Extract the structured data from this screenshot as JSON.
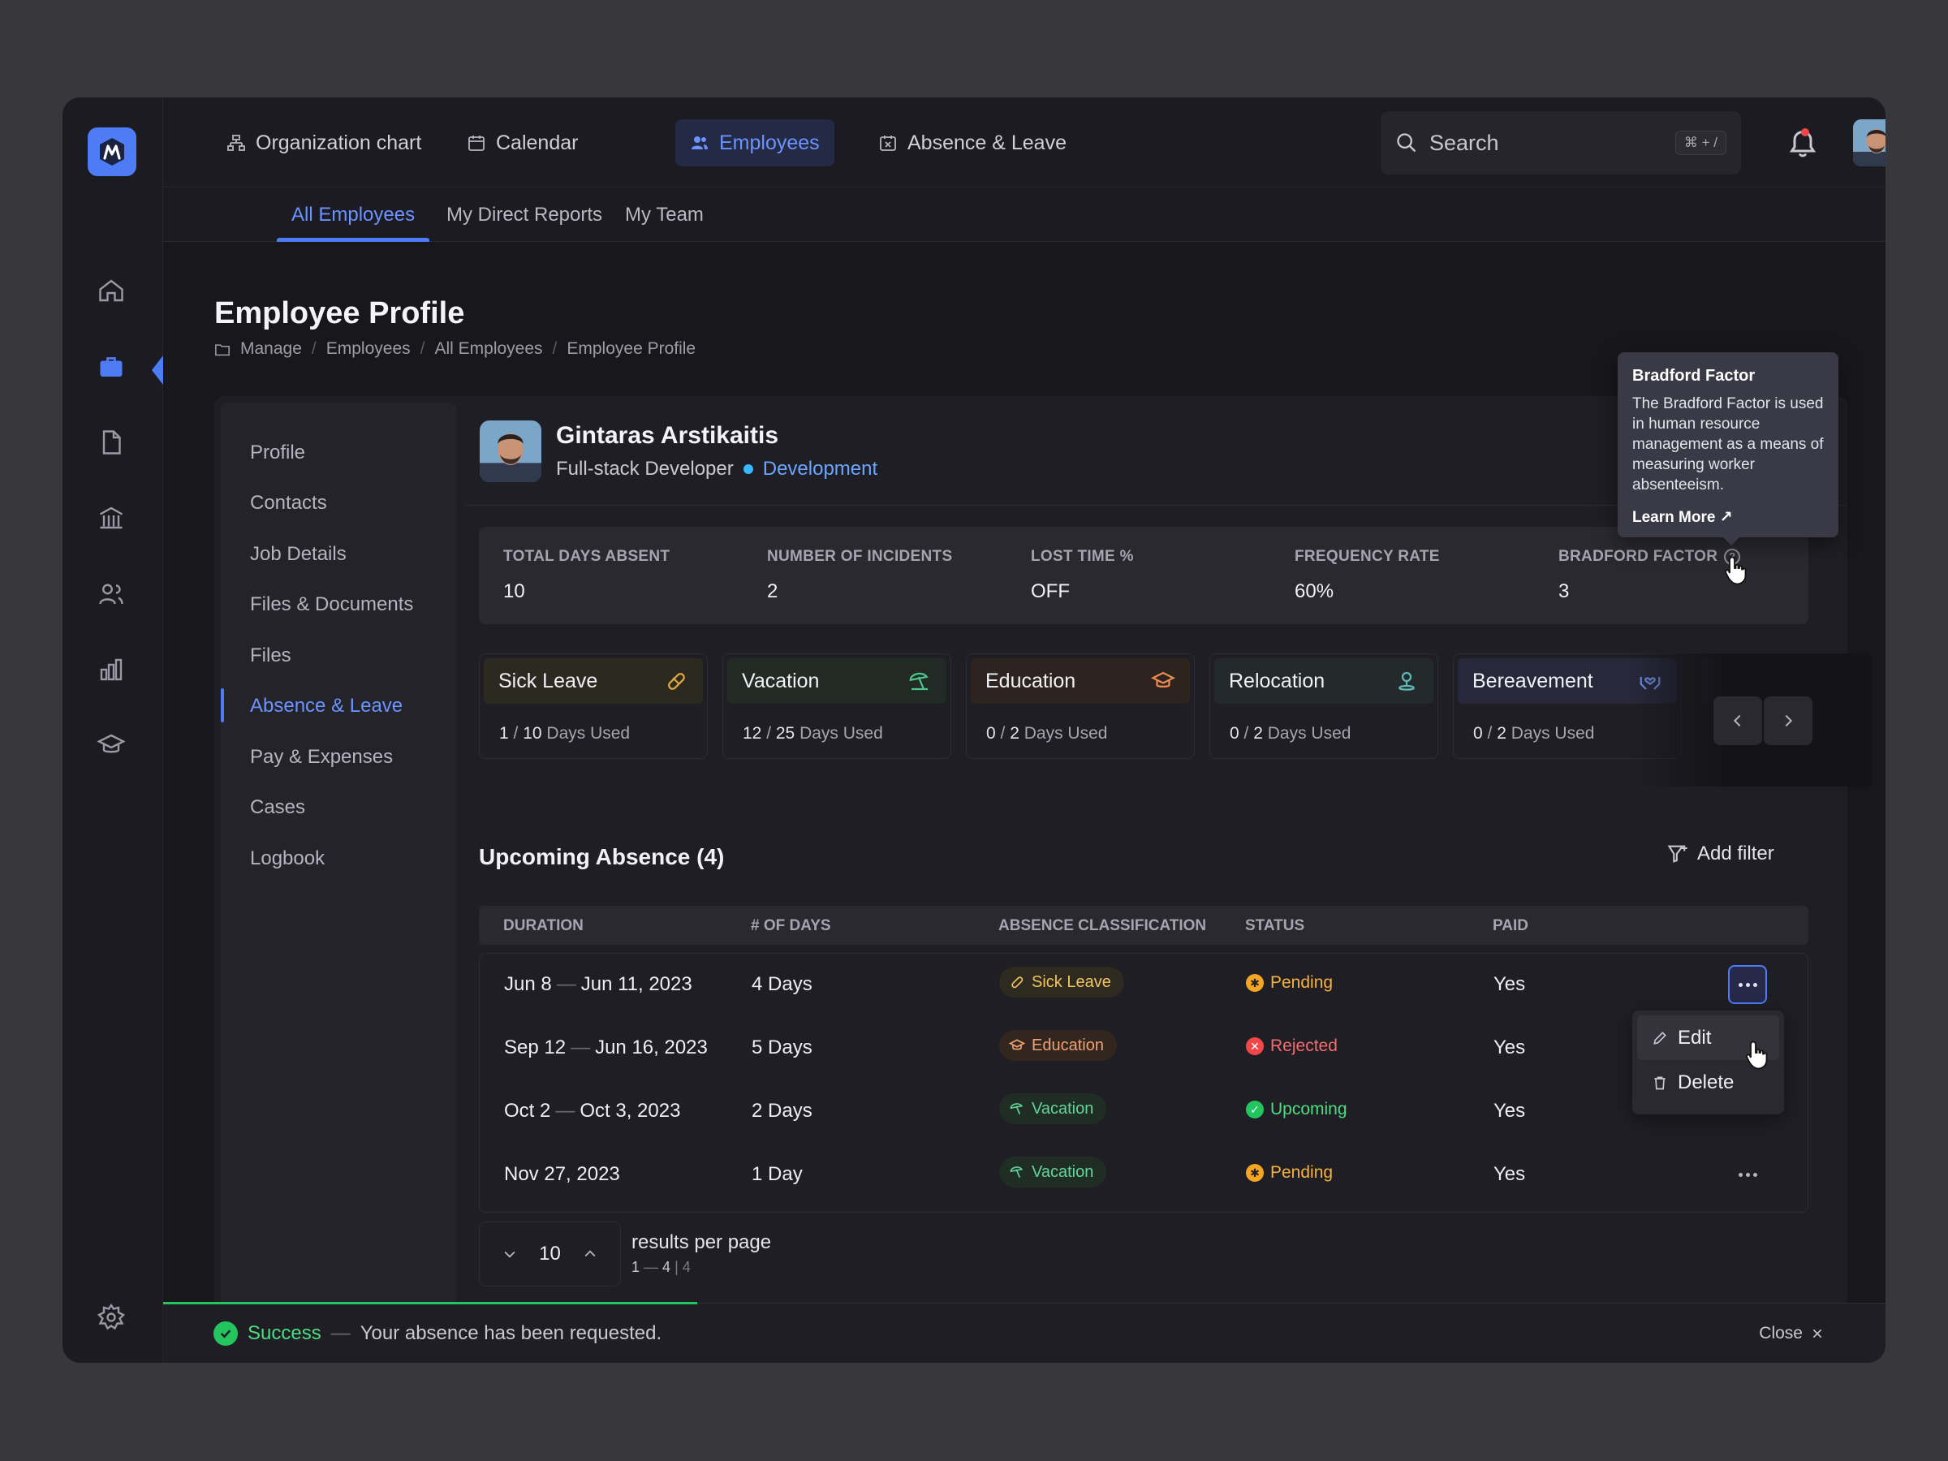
{
  "colors": {
    "accent": "#4d7cf5",
    "success": "#22c55e",
    "pending": "#f5a524",
    "rejected": "#f0474b"
  },
  "nav": {
    "items": [
      {
        "label": "Organization chart",
        "icon": "org-chart-icon"
      },
      {
        "label": "Calendar",
        "icon": "calendar-icon"
      },
      {
        "label": "Employees",
        "icon": "users-icon",
        "active": true
      },
      {
        "label": "Absence & Leave",
        "icon": "calendar-x-icon"
      }
    ]
  },
  "search": {
    "placeholder": "Search",
    "shortcut": "⌘ + /"
  },
  "subtabs": [
    "All Employees",
    "My Direct Reports",
    "My Team"
  ],
  "page": {
    "title": "Employee Profile",
    "breadcrumb": [
      "Manage",
      "Employees",
      "All Employees",
      "Employee Profile"
    ]
  },
  "side_menu": [
    "Profile",
    "Contacts",
    "Job Details",
    "Files & Documents",
    "Files",
    "Absence & Leave",
    "Pay & Expenses",
    "Cases",
    "Logbook"
  ],
  "employee": {
    "name": "Gintaras Arstikaitis",
    "role": "Full-stack Developer",
    "department": "Development"
  },
  "stats": [
    {
      "label": "TOTAL DAYS ABSENT",
      "value": "10"
    },
    {
      "label": "NUMBER OF INCIDENTS",
      "value": "2"
    },
    {
      "label": "LOST TIME %",
      "value": "OFF"
    },
    {
      "label": "FREQUENCY RATE",
      "value": "60%"
    },
    {
      "label": "BRADFORD FACTOR",
      "value": "3"
    }
  ],
  "tooltip": {
    "title": "Bradford Factor",
    "body": "The Bradford Factor is used in human resource management as a means of measuring worker absenteeism.",
    "link": "Learn More ↗"
  },
  "leave_cards": [
    {
      "name": "Sick Leave",
      "used": "1",
      "total": "10",
      "suffix": "Days Used",
      "icon": "pill-icon"
    },
    {
      "name": "Vacation",
      "used": "12",
      "total": "25",
      "suffix": "Days Used",
      "icon": "umbrella-icon"
    },
    {
      "name": "Education",
      "used": "0",
      "total": "2",
      "suffix": "Days Used",
      "icon": "graduation-cap-icon"
    },
    {
      "name": "Relocation",
      "used": "0",
      "total": "2",
      "suffix": "Days Used",
      "icon": "location-pin-icon"
    },
    {
      "name": "Bereavement",
      "used": "0",
      "total": "2",
      "suffix": "Days Used",
      "icon": "hands-heart-icon"
    }
  ],
  "upcoming": {
    "title": "Upcoming Absence (4)",
    "add_filter": "Add filter",
    "columns": [
      "DURATION",
      "# OF DAYS",
      "ABSENCE CLASSIFICATION",
      "STATUS",
      "PAID"
    ],
    "rows": [
      {
        "from": "Jun 8",
        "to": "Jun 11, 2023",
        "days": "4 Days",
        "classification": "Sick Leave",
        "status": "Pending",
        "paid": "Yes"
      },
      {
        "from": "Sep 12",
        "to": "Jun 16, 2023",
        "days": "5 Days",
        "classification": "Education",
        "status": "Rejected",
        "paid": "Yes"
      },
      {
        "from": "Oct 2",
        "to": "Oct 3, 2023",
        "days": "2 Days",
        "classification": "Vacation",
        "status": "Upcoming",
        "paid": "Yes"
      },
      {
        "from": "",
        "to": "Nov 27, 2023",
        "days": "1 Day",
        "classification": "Vacation",
        "status": "Pending",
        "paid": "Yes"
      }
    ],
    "menu": [
      "Edit",
      "Delete"
    ]
  },
  "pager": {
    "per_page": "10",
    "label": "results per page",
    "range_start": "1",
    "range_end": "4",
    "total": "4"
  },
  "toast": {
    "title": "Success",
    "message": "Your absence has been requested.",
    "close": "Close",
    "progress": 0.31
  }
}
